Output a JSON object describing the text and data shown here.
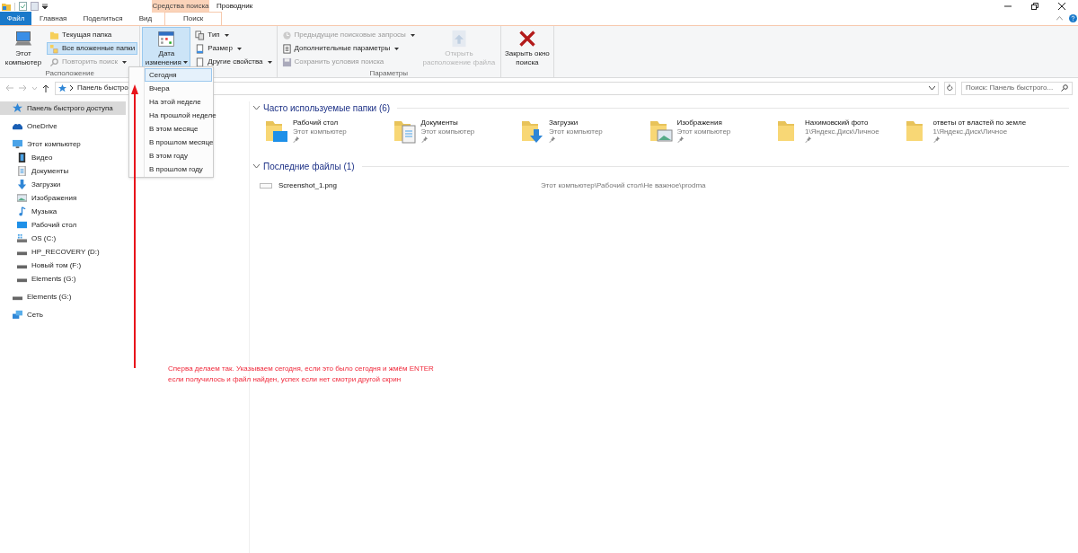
{
  "title_bar": {
    "context_tab": "Средства поиска",
    "title": "Проводник"
  },
  "ribbon_tabs": [
    {
      "label": "Файл",
      "kind": "file",
      "selected": false
    },
    {
      "label": "Главная",
      "kind": "tab",
      "selected": false
    },
    {
      "label": "Поделиться",
      "kind": "tab",
      "selected": false
    },
    {
      "label": "Вид",
      "kind": "tab",
      "selected": false
    },
    {
      "label": "Поиск",
      "kind": "context",
      "selected": true
    }
  ],
  "ribbon_groups": [
    {
      "label": "Расположение",
      "items": [
        {
          "kind": "large",
          "label": "Этот компьютер",
          "disabled": false,
          "pressed": false,
          "has_menu": false
        },
        {
          "kind": "small",
          "label": "Текущая папка",
          "disabled": false,
          "pressed": false,
          "has_menu": false
        },
        {
          "kind": "small",
          "label": "Все вложенные папки",
          "disabled": false,
          "pressed": true,
          "has_menu": false
        },
        {
          "kind": "small",
          "label": "Повторить поиск",
          "disabled": true,
          "pressed": false,
          "has_menu": true
        }
      ]
    },
    {
      "items": [
        {
          "kind": "large",
          "label": "Дата изменения",
          "disabled": false,
          "pressed": true,
          "has_menu": true
        },
        {
          "kind": "small",
          "label": "Тип",
          "disabled": false,
          "pressed": false,
          "has_menu": true
        },
        {
          "kind": "small",
          "label": "Размер",
          "disabled": false,
          "pressed": false,
          "has_menu": true
        },
        {
          "kind": "small",
          "label": "Другие свойства",
          "disabled": false,
          "pressed": false,
          "has_menu": true
        }
      ]
    },
    {
      "label": "Параметры",
      "items": [
        {
          "kind": "small",
          "label": "Предыдущие поисковые запросы",
          "disabled": true,
          "pressed": false,
          "has_menu": true
        },
        {
          "kind": "small",
          "label": "Дополнительные параметры",
          "disabled": false,
          "pressed": false,
          "has_menu": true
        },
        {
          "kind": "small",
          "label": "Сохранить условия поиска",
          "disabled": true,
          "pressed": false,
          "has_menu": false
        },
        {
          "kind": "large",
          "label": "Открыть расположение файла",
          "disabled": true,
          "pressed": false,
          "has_menu": false
        }
      ]
    },
    {
      "items": [
        {
          "kind": "large",
          "label": "Закрыть окно поиска",
          "disabled": false,
          "pressed": false,
          "has_menu": false
        }
      ]
    }
  ],
  "date_menu": [
    {
      "label": "Сегодня",
      "selected": true
    },
    {
      "label": "Вчера",
      "selected": false
    },
    {
      "label": "На этой неделе",
      "selected": false
    },
    {
      "label": "На прошлой неделе",
      "selected": false
    },
    {
      "label": "В этом месяце",
      "selected": false
    },
    {
      "label": "В прошлом месяце",
      "selected": false
    },
    {
      "label": "В этом году",
      "selected": false
    },
    {
      "label": "В прошлом году",
      "selected": false
    }
  ],
  "address_bar": {
    "path": "Панель быстро"
  },
  "search": {
    "placeholder": "Поиск: Панель быстрого..."
  },
  "sidebar": [
    {
      "label": "Панель быстрого доступа",
      "kind": "star",
      "selected": true
    },
    {
      "label": "OneDrive",
      "kind": "cloud",
      "selected": false
    },
    {
      "label": "Этот компьютер",
      "kind": "pc",
      "selected": false,
      "children": [
        {
          "label": "Видео",
          "kind": "video",
          "selected": false
        },
        {
          "label": "Документы",
          "kind": "docs",
          "selected": false
        },
        {
          "label": "Загрузки",
          "kind": "download",
          "selected": false
        },
        {
          "label": "Изображения",
          "kind": "pictures",
          "selected": false
        },
        {
          "label": "Музыка",
          "kind": "music",
          "selected": false
        },
        {
          "label": "Рабочий стол",
          "kind": "desktop",
          "selected": false
        },
        {
          "label": "OS (C:)",
          "kind": "osdrive",
          "selected": false
        },
        {
          "label": "HP_RECOVERY (D:)",
          "kind": "drive",
          "selected": false
        },
        {
          "label": "Новый том (F:)",
          "kind": "drive",
          "selected": false
        },
        {
          "label": "Elements (G:)",
          "kind": "drive",
          "selected": false
        }
      ]
    },
    {
      "label": "Elements (G:)",
      "kind": "drive",
      "selected": false
    },
    {
      "label": "Сеть",
      "kind": "network",
      "selected": false
    }
  ],
  "frequent_folders": {
    "title": "Часто используемые папки (6)",
    "items": [
      {
        "name": "Рабочий стол",
        "location": "Этот компьютер",
        "kind": "desktop"
      },
      {
        "name": "Документы",
        "location": "Этот компьютер",
        "kind": "docs"
      },
      {
        "name": "Загрузки",
        "location": "Этот компьютер",
        "kind": "download"
      },
      {
        "name": "Изображения",
        "location": "Этот компьютер",
        "kind": "pictures"
      },
      {
        "name": "Нахимовский фото",
        "location": "1\\Яндекс.Диск\\Личное",
        "kind": "plain"
      },
      {
        "name": "ответы от властей по земле",
        "location": "1\\Яндекс.Диск\\Личное",
        "kind": "plain"
      }
    ]
  },
  "recent_files": {
    "title": "Последние файлы (1)",
    "items": [
      {
        "name": "Screenshot_1.png",
        "path": "Этот компьютер\\Рабочий стол\\Не важное\\prodma"
      }
    ]
  },
  "annotation": {
    "lines": [
      "Сперва делаем так. Указываем сегодня, если это было сегодня и жмём ENTER",
      "если получилось и файл найден, успех если нет смотри другой скрин"
    ]
  }
}
